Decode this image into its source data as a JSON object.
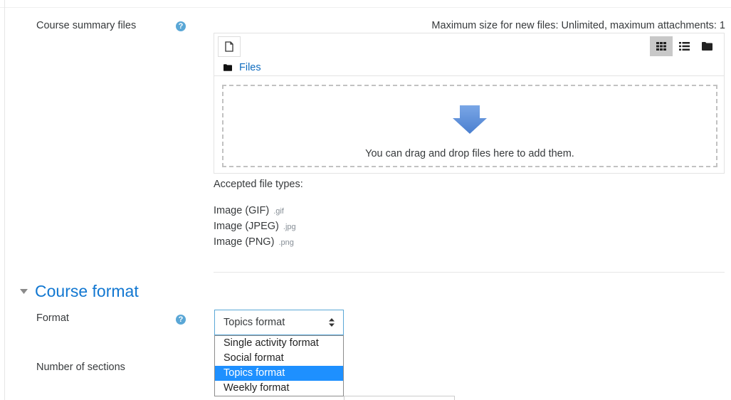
{
  "course_summary": {
    "label": "Course summary files",
    "help_glyph": "?",
    "max_size_text": "Maximum size for new files: Unlimited, maximum attachments: 1"
  },
  "filepicker": {
    "path_folder": "Files",
    "dropzone_text": "You can drag and drop files here to add them.",
    "view_modes": [
      "icons",
      "list",
      "tree"
    ],
    "active_view": "icons"
  },
  "accepted": {
    "heading": "Accepted file types:",
    "types": [
      {
        "name": "Image (GIF)",
        "ext": ".gif"
      },
      {
        "name": "Image (JPEG)",
        "ext": ".jpg"
      },
      {
        "name": "Image (PNG)",
        "ext": ".png"
      }
    ]
  },
  "course_format": {
    "section_title": "Course format",
    "format_label": "Format",
    "format_selected": "Topics format",
    "format_options": [
      "Single activity format",
      "Social format",
      "Topics format",
      "Weekly format"
    ],
    "sections_label": "Number of sections"
  },
  "colors": {
    "accent": "#1177d1",
    "link": "#0f6cbf",
    "help": "#5aa7d6",
    "selected_option": "#1e90ff",
    "dropzone_arrow": "#5b8fd6"
  }
}
